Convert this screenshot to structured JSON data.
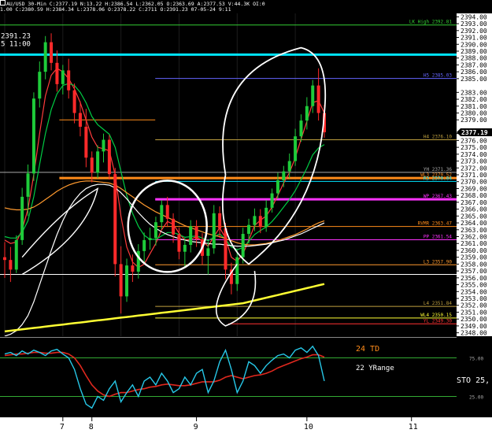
{
  "header": {
    "line1": "AU/USD 30-Min C:2377.19 N:13.22 H:2386.54 L:2362.05 O:2363.69 A:2377.53 V:44.3K OI:0",
    "line2": "1.00 C:2380.59 H:2384.34 L:2378.06 O:2378.22 C:2711 O:2391.23 07-05-24 9:11"
  },
  "chart_data": {
    "type": "line",
    "symbol": "AU/USD",
    "timeframe": "30-Min",
    "ylim": [
      2347.5,
      2394.5
    ],
    "yticks": [
      2394,
      2393,
      2392,
      2391,
      2390,
      2389,
      2388,
      2387,
      2386,
      2385,
      2383,
      2382,
      2381,
      2380,
      2379,
      2377,
      2376,
      2375,
      2374,
      2373,
      2372,
      2371,
      2370,
      2369,
      2368,
      2367,
      2366,
      2365,
      2364,
      2363,
      2362,
      2361,
      2360,
      2359,
      2358,
      2357,
      2356,
      2355,
      2354,
      2353,
      2352,
      2351,
      2350,
      2349,
      2348
    ],
    "ytick_labels": [
      "2394.00",
      "2393.00",
      "2392.00",
      "2391.00",
      "2390.00",
      "2389.00",
      "2388.00",
      "2387.00",
      "2386.00",
      "2385.00",
      "2383.00",
      "2382.00",
      "2381.00",
      "2380.00",
      "2379.00",
      "2377.00",
      "2376.00",
      "2375.00",
      "2374.00",
      "2373.00",
      "2372.00",
      "2371.00",
      "2370.00",
      "2369.00",
      "2368.00",
      "2367.00",
      "2366.00",
      "2365.00",
      "2364.00",
      "2363.00",
      "2362.00",
      "2361.00",
      "2360.00",
      "2359.00",
      "2358.00",
      "2357.00",
      "2356.00",
      "2355.00",
      "2354.00",
      "2353.00",
      "2352.00",
      "2351.00",
      "2350.00",
      "2349.00",
      "2348.00"
    ],
    "last_price": 2377.19,
    "last_price_label": "2377.19",
    "top_left_price": "2391.23",
    "top_left_time": "5 11:00",
    "x_day_labels": [
      {
        "label": "7",
        "bar": 10
      },
      {
        "label": "8",
        "bar": 15
      },
      {
        "label": "9",
        "bar": 33
      },
      {
        "label": "10",
        "bar": 52
      },
      {
        "label": "11",
        "bar": 70
      }
    ],
    "bars_count": 82,
    "candles": [
      [
        2359.0,
        2361.2,
        2356.0,
        2358.6
      ],
      [
        2358.6,
        2360.5,
        2355.4,
        2357.2
      ],
      [
        2357.2,
        2362.2,
        2356.7,
        2361.5
      ],
      [
        2361.5,
        2369.1,
        2360.8,
        2367.8
      ],
      [
        2367.8,
        2372.5,
        2365.0,
        2371.2
      ],
      [
        2371.2,
        2383.0,
        2370.1,
        2382.1
      ],
      [
        2382.1,
        2387.5,
        2380.8,
        2386.0
      ],
      [
        2386.0,
        2391.2,
        2384.9,
        2390.3
      ],
      [
        2390.3,
        2391.6,
        2386.2,
        2387.3
      ],
      [
        2387.3,
        2389.1,
        2383.1,
        2384.2
      ],
      [
        2384.2,
        2387.0,
        2382.7,
        2386.2
      ],
      [
        2386.2,
        2387.9,
        2382.1,
        2383.3
      ],
      [
        2383.3,
        2384.3,
        2378.5,
        2380.0
      ],
      [
        2380.0,
        2381.7,
        2376.6,
        2378.0
      ],
      [
        2378.0,
        2380.6,
        2372.1,
        2373.5
      ],
      [
        2373.5,
        2374.4,
        2369.9,
        2371.3
      ],
      [
        2371.3,
        2375.3,
        2370.5,
        2374.4
      ],
      [
        2374.4,
        2377.0,
        2372.8,
        2376.1
      ],
      [
        2376.1,
        2376.8,
        2370.3,
        2371.1
      ],
      [
        2371.1,
        2372.0,
        2356.2,
        2358.0
      ],
      [
        2358.0,
        2360.6,
        2350.8,
        2353.3
      ],
      [
        2353.3,
        2358.8,
        2352.5,
        2357.8
      ],
      [
        2357.8,
        2359.4,
        2355.4,
        2356.9
      ],
      [
        2356.9,
        2360.9,
        2355.9,
        2359.9
      ],
      [
        2359.9,
        2362.6,
        2358.0,
        2361.5
      ],
      [
        2361.5,
        2363.3,
        2360.1,
        2361.8
      ],
      [
        2361.8,
        2364.9,
        2360.7,
        2364.1
      ],
      [
        2364.1,
        2367.3,
        2363.1,
        2366.6
      ],
      [
        2366.6,
        2367.8,
        2363.4,
        2364.6
      ],
      [
        2364.6,
        2365.4,
        2361.1,
        2362.3
      ],
      [
        2362.3,
        2363.3,
        2358.7,
        2359.8
      ],
      [
        2359.8,
        2361.8,
        2357.6,
        2360.8
      ],
      [
        2360.8,
        2364.4,
        2359.7,
        2363.5
      ],
      [
        2363.5,
        2364.4,
        2360.5,
        2361.6
      ],
      [
        2361.6,
        2362.5,
        2357.9,
        2359.2
      ],
      [
        2359.2,
        2361.3,
        2356.5,
        2360.3
      ],
      [
        2360.3,
        2366.6,
        2359.5,
        2365.4
      ],
      [
        2365.4,
        2366.4,
        2361.8,
        2363.2
      ],
      [
        2363.2,
        2364.0,
        2355.8,
        2357.2
      ],
      [
        2357.2,
        2358.2,
        2353.6,
        2355.1
      ],
      [
        2355.1,
        2360.1,
        2354.1,
        2359.0
      ],
      [
        2359.0,
        2363.3,
        2358.1,
        2362.4
      ],
      [
        2362.4,
        2364.6,
        2361.0,
        2363.7
      ],
      [
        2363.7,
        2366.1,
        2362.8,
        2365.0
      ],
      [
        2365.0,
        2366.0,
        2362.5,
        2363.4
      ],
      [
        2363.4,
        2367.3,
        2362.7,
        2366.2
      ],
      [
        2366.2,
        2369.0,
        2365.5,
        2368.3
      ],
      [
        2368.3,
        2371.3,
        2367.5,
        2370.2
      ],
      [
        2370.2,
        2372.3,
        2369.2,
        2371.5
      ],
      [
        2371.5,
        2374.1,
        2370.5,
        2373.0
      ],
      [
        2373.0,
        2377.7,
        2372.3,
        2376.6
      ],
      [
        2376.6,
        2379.8,
        2375.8,
        2378.9
      ],
      [
        2378.9,
        2382.3,
        2377.6,
        2381.0
      ],
      [
        2381.0,
        2384.8,
        2380.0,
        2384.0
      ],
      [
        2384.0,
        2386.5,
        2378.9,
        2380.0
      ],
      [
        2380.0,
        2381.2,
        2376.4,
        2377.2
      ]
    ],
    "moving_averages": [
      {
        "color": "#ff3b3b",
        "values": [
          2361.5,
          2361.0,
          2361.2,
          2363.0,
          2366.0,
          2371.0,
          2377.0,
          2382.5,
          2385.5,
          2386.5,
          2386.0,
          2385.0,
          2383.5,
          2381.5,
          2379.0,
          2376.5,
          2375.0,
          2374.8,
          2374.5,
          2371.0,
          2365.0,
          2360.5,
          2358.3,
          2357.5,
          2358.0,
          2359.5,
          2361.0,
          2363.0,
          2364.2,
          2363.8,
          2362.5,
          2361.5,
          2361.6,
          2362.0,
          2361.3,
          2360.6,
          2362.0,
          2363.3,
          2361.8,
          2359.0,
          2358.4,
          2359.5,
          2361.5,
          2363.6,
          2364.4,
          2365.0,
          2366.3,
          2368.0,
          2369.8,
          2371.3,
          2373.5,
          2376.2,
          2378.8,
          2381.5,
          2381.8,
          2380.0
        ]
      },
      {
        "color": "#00cc44",
        "values": [
          2362.0,
          2361.8,
          2361.8,
          2362.6,
          2364.3,
          2367.8,
          2372.5,
          2377.0,
          2380.5,
          2382.8,
          2384.0,
          2384.3,
          2384.0,
          2383.0,
          2381.5,
          2379.5,
          2378.3,
          2377.6,
          2376.9,
          2375.0,
          2371.5,
          2368.0,
          2365.4,
          2363.5,
          2362.2,
          2361.6,
          2361.6,
          2362.1,
          2362.6,
          2362.6,
          2362.3,
          2361.9,
          2362.0,
          2362.1,
          2361.8,
          2361.4,
          2361.9,
          2362.4,
          2361.6,
          2360.5,
          2360.1,
          2360.4,
          2361.3,
          2362.3,
          2362.9,
          2363.4,
          2364.2,
          2365.2,
          2366.3,
          2367.4,
          2368.7,
          2370.3,
          2372.0,
          2373.9,
          2374.9,
          2375.4
        ]
      },
      {
        "color": "#ff9a2e",
        "values": [
          2366.2,
          2366.0,
          2365.9,
          2365.9,
          2366.0,
          2366.3,
          2366.8,
          2367.4,
          2368.0,
          2368.6,
          2369.1,
          2369.5,
          2369.8,
          2370.0,
          2370.1,
          2370.1,
          2370.0,
          2369.9,
          2369.8,
          2369.5,
          2369.0,
          2368.4,
          2367.8,
          2367.2,
          2366.6,
          2366.1,
          2365.6,
          2365.2,
          2364.8,
          2364.4,
          2364.0,
          2363.6,
          2363.3,
          2363.0,
          2362.7,
          2362.4,
          2362.2,
          2362.0,
          2361.7,
          2361.4,
          2361.1,
          2360.9,
          2360.8,
          2360.8,
          2360.9,
          2361.0,
          2361.2,
          2361.4,
          2361.7,
          2362.0,
          2362.3,
          2362.7,
          2363.1,
          2363.6,
          2364.0,
          2364.3
        ]
      },
      {
        "color": "#ffffff",
        "values": [
          2347.5,
          2347.8,
          2348.3,
          2349.2,
          2350.5,
          2352.5,
          2355.0,
          2357.5,
          2360.0,
          2362.3,
          2364.3,
          2366.0,
          2367.3,
          2368.3,
          2369.0,
          2369.4,
          2369.6,
          2369.6,
          2369.5,
          2369.1,
          2368.4,
          2367.5,
          2366.5,
          2365.5,
          2364.6,
          2363.8,
          2363.2,
          2362.7,
          2362.3,
          2362.0,
          2361.7,
          2361.5,
          2361.3,
          2361.2,
          2361.1,
          2361.0,
          2360.9,
          2360.9,
          2360.8,
          2360.7,
          2360.6,
          2360.6,
          2360.6,
          2360.7,
          2360.8,
          2360.9,
          2361.1,
          2361.3,
          2361.5,
          2361.8,
          2362.1,
          2362.4,
          2362.8,
          2363.2,
          2363.6,
          2364.0
        ]
      },
      {
        "color": "#ffff33",
        "values": [
          2348.2,
          2348.3,
          2348.4,
          2348.5,
          2348.6,
          2348.7,
          2348.8,
          2348.9,
          2349.0,
          2349.1,
          2349.2,
          2349.3,
          2349.4,
          2349.5,
          2349.6,
          2349.7,
          2349.8,
          2349.9,
          2350.0,
          2350.1,
          2350.2,
          2350.3,
          2350.4,
          2350.5,
          2350.6,
          2350.7,
          2350.8,
          2350.9,
          2351.0,
          2351.1,
          2351.2,
          2351.3,
          2351.4,
          2351.5,
          2351.6,
          2351.7,
          2351.8,
          2351.9,
          2352.0,
          2352.1,
          2352.2,
          2352.3,
          2352.5,
          2352.7,
          2352.9,
          2353.1,
          2353.3,
          2353.5,
          2353.7,
          2353.9,
          2354.1,
          2354.3,
          2354.5,
          2354.7,
          2354.9,
          2355.1
        ]
      }
    ],
    "levels": [
      {
        "price": 2392.81,
        "color": "#33cc33",
        "label": "LK High 2392.81",
        "from": 0.0,
        "label_side": "right"
      },
      {
        "price": 2388.5,
        "color": "#00e5ff",
        "label": "",
        "from": 0.0,
        "thick": true
      },
      {
        "price": 2385.03,
        "color": "#6666ff",
        "label": "H5 2385.03",
        "from": 0.34,
        "label_side": "right"
      },
      {
        "price": 2379.0,
        "color": "#ff8c1a",
        "label": "",
        "from": 0.13,
        "to": 0.34
      },
      {
        "price": 2376.1,
        "color": "#bfa040",
        "label": "H4 2376.10",
        "from": 0.34,
        "label_side": "right"
      },
      {
        "price": 2371.36,
        "color": "#aaaaaa",
        "label": "YH 2371.36",
        "from": 0.0,
        "label_side": "right"
      },
      {
        "price": 2370.52,
        "color": "#ff8c1a",
        "label": "WL3 2370.52",
        "from": 0.13,
        "thick": true,
        "label_side": "right"
      },
      {
        "price": 2370.04,
        "color": "#00e5ff",
        "label": "R3 2370.04",
        "from": 0.34,
        "label_side": "right"
      },
      {
        "price": 2367.43,
        "color": "#ff33ff",
        "label": "WP 2367.43",
        "from": 0.34,
        "thick": true,
        "label_side": "right"
      },
      {
        "price": 2363.47,
        "color": "#ff8c1a",
        "label": "RVMR 2363.47",
        "from": 0.34,
        "label_side": "right"
      },
      {
        "price": 2361.54,
        "color": "#ff33ff",
        "label": "PP 2361.54",
        "from": 0.34,
        "label_side": "right"
      },
      {
        "price": 2357.9,
        "color": "#ff9a2e",
        "label": "L3 2357.90",
        "from": 0.34,
        "label_side": "right"
      },
      {
        "price": 2356.5,
        "color": "#ffffff",
        "label": "",
        "from": 0.0
      },
      {
        "price": 2351.84,
        "color": "#bfa040",
        "label": "L4 2351.84",
        "from": 0.34,
        "label_side": "right"
      },
      {
        "price": 2350.15,
        "color": "#ffff33",
        "label": "WL4 2350.15",
        "from": 0.34,
        "label_side": "right"
      },
      {
        "price": 2349.3,
        "color": "#ff3333",
        "label": "YL 2349.30",
        "from": 0.5,
        "label_side": "right"
      }
    ],
    "oscillator": {
      "label_td": "24 TD",
      "label_yrange": "22 YRange",
      "label_sto": "STO 25,",
      "levels": [
        {
          "value": 75,
          "label": "75.00"
        },
        {
          "value": 25,
          "label": "25.00"
        }
      ],
      "ylim": [
        0,
        100
      ],
      "sto": [
        80,
        82,
        78,
        84,
        80,
        85,
        82,
        78,
        84,
        86,
        80,
        75,
        60,
        35,
        15,
        10,
        25,
        20,
        35,
        45,
        18,
        30,
        40,
        25,
        45,
        50,
        40,
        55,
        45,
        30,
        35,
        50,
        40,
        55,
        60,
        30,
        45,
        70,
        85,
        60,
        30,
        45,
        70,
        65,
        55,
        65,
        72,
        78,
        80,
        75,
        85,
        88,
        82,
        90,
        78,
        45
      ],
      "sto_ma": [
        78,
        79,
        80,
        80,
        81,
        82,
        82,
        81,
        81,
        82,
        82,
        80,
        75,
        65,
        52,
        40,
        32,
        27,
        25,
        28,
        30,
        30,
        32,
        34,
        35,
        37,
        38,
        40,
        41,
        40,
        39,
        39,
        40,
        42,
        44,
        44,
        44,
        46,
        50,
        52,
        50,
        48,
        50,
        52,
        53,
        55,
        58,
        62,
        65,
        68,
        71,
        74,
        76,
        79,
        79,
        76
      ]
    }
  }
}
